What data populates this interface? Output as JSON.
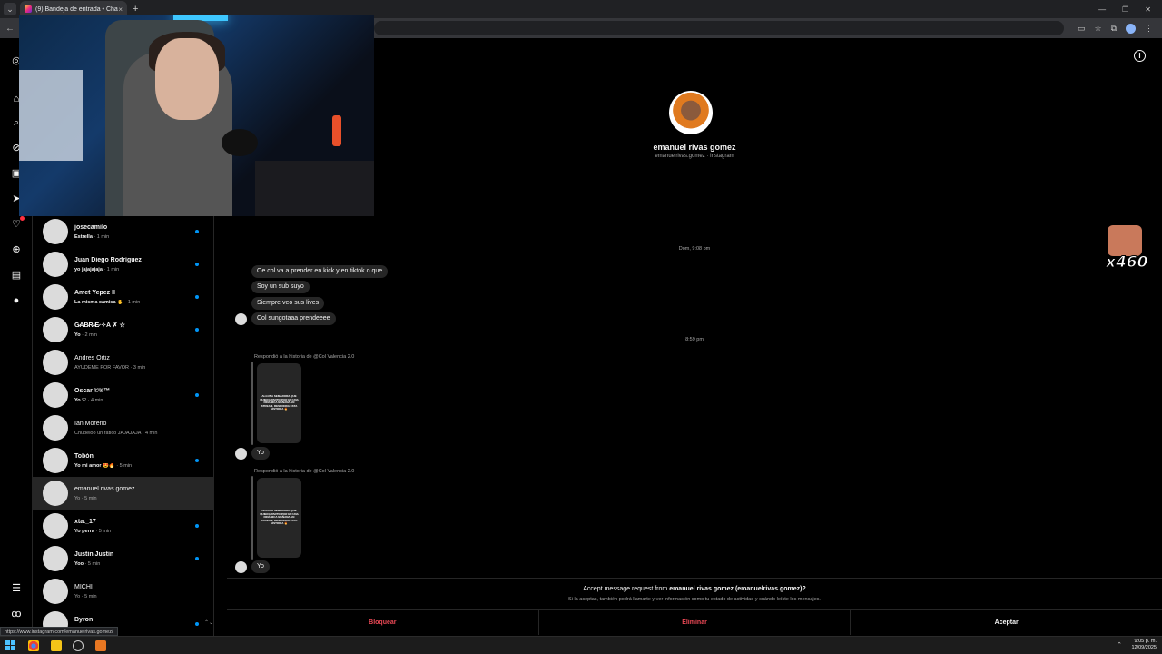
{
  "browser": {
    "tab_title": "(9) Bandeja de entrada • Chats",
    "tab_close": "×",
    "new_tab": "+",
    "status_url": "https://www.instagram.com/emanuelrivas.gomez/"
  },
  "inbox": {
    "conversations": [
      {
        "name": "josecamilo",
        "preview": "Estrella",
        "time": " · 1 min",
        "unread": true
      },
      {
        "name": "Juan Diego Rodríguez",
        "preview": "yo jajajajaja",
        "time": " · 1 min",
        "unread": true
      },
      {
        "name": "Amet Yepez II",
        "preview": "La misma camisa ✋",
        "time": " · 1 min",
        "unread": true
      },
      {
        "name": "G̷A̷B̷R̷I̷E̷ ✧A ✗ ☆",
        "preview": "Yo",
        "time": " · 2 min",
        "unread": true
      },
      {
        "name": "Andres Ortiz",
        "preview": "AYUDEME POR FAVOR",
        "time": " · 3 min",
        "unread": false
      },
      {
        "name": "Oscar ©®™",
        "preview": "Yo ♡",
        "time": " · 4 min",
        "unread": true
      },
      {
        "name": "Ian Moreno",
        "preview": "Chupeloo un ratico JAJAJAJA",
        "time": " · 4 min",
        "unread": false
      },
      {
        "name": "Tobón",
        "preview": "Yo mi amor 😍🔥",
        "time": " · 5 min",
        "unread": true
      },
      {
        "name": "emanuel rivas gomez",
        "preview": "Yo",
        "time": " · 5 min",
        "unread": false,
        "active": true
      },
      {
        "name": "xta._17",
        "preview": "Yo perra",
        "time": " · 5 min",
        "unread": true
      },
      {
        "name": "Justin Justin",
        "preview": "Yoo",
        "time": " · 5 min",
        "unread": true
      },
      {
        "name": "MICHI",
        "preview": "Yo",
        "time": " · 5 min",
        "unread": false
      },
      {
        "name": "Byron",
        "preview": "Yo",
        "time": " · 6 min",
        "unread": true
      }
    ]
  },
  "chat": {
    "profile_name": "emanuel rivas gomez",
    "profile_sub": "emanuelrivas.gomez · Instagram",
    "timestamp1": "Dom, 9:08 pm",
    "messages1": [
      "Oe col va a prender en kick y en tiktok o que",
      "Soy un sub suyo",
      "Siempre veo sus lives",
      "Col sungotaaa prendeeee"
    ],
    "timestamp2": "8:59 pm",
    "reply_label": "Respondió a la historia de @Col Valencia 2.0",
    "story_text": "ALGUNA SEMADORA QUE QUIERA PARTICIPAR EN UNA DINÁMICA MAÑANA EN STREAM, RESPONDA ESTA HISTORIA 🔥",
    "reply_msg": "Yo"
  },
  "request": {
    "title_prefix": "Accept message request from ",
    "title_name": "emanuel rivas gomez (emanuelrivas.gomez)?",
    "subtitle": "Si la aceptas, también podrá llamarte y ver información como tu estado de actividad y cuándo leíste los mensajes.",
    "block": "Bloquear",
    "delete": "Eliminar",
    "accept": "Aceptar"
  },
  "overlay": {
    "emote_count": "x460"
  },
  "taskbar": {
    "time": "9:05 p. m.",
    "date": "12/09/2025"
  },
  "colors": {
    "accent": "#0095f6",
    "danger": "#ed4956",
    "bubble": "#262626"
  }
}
